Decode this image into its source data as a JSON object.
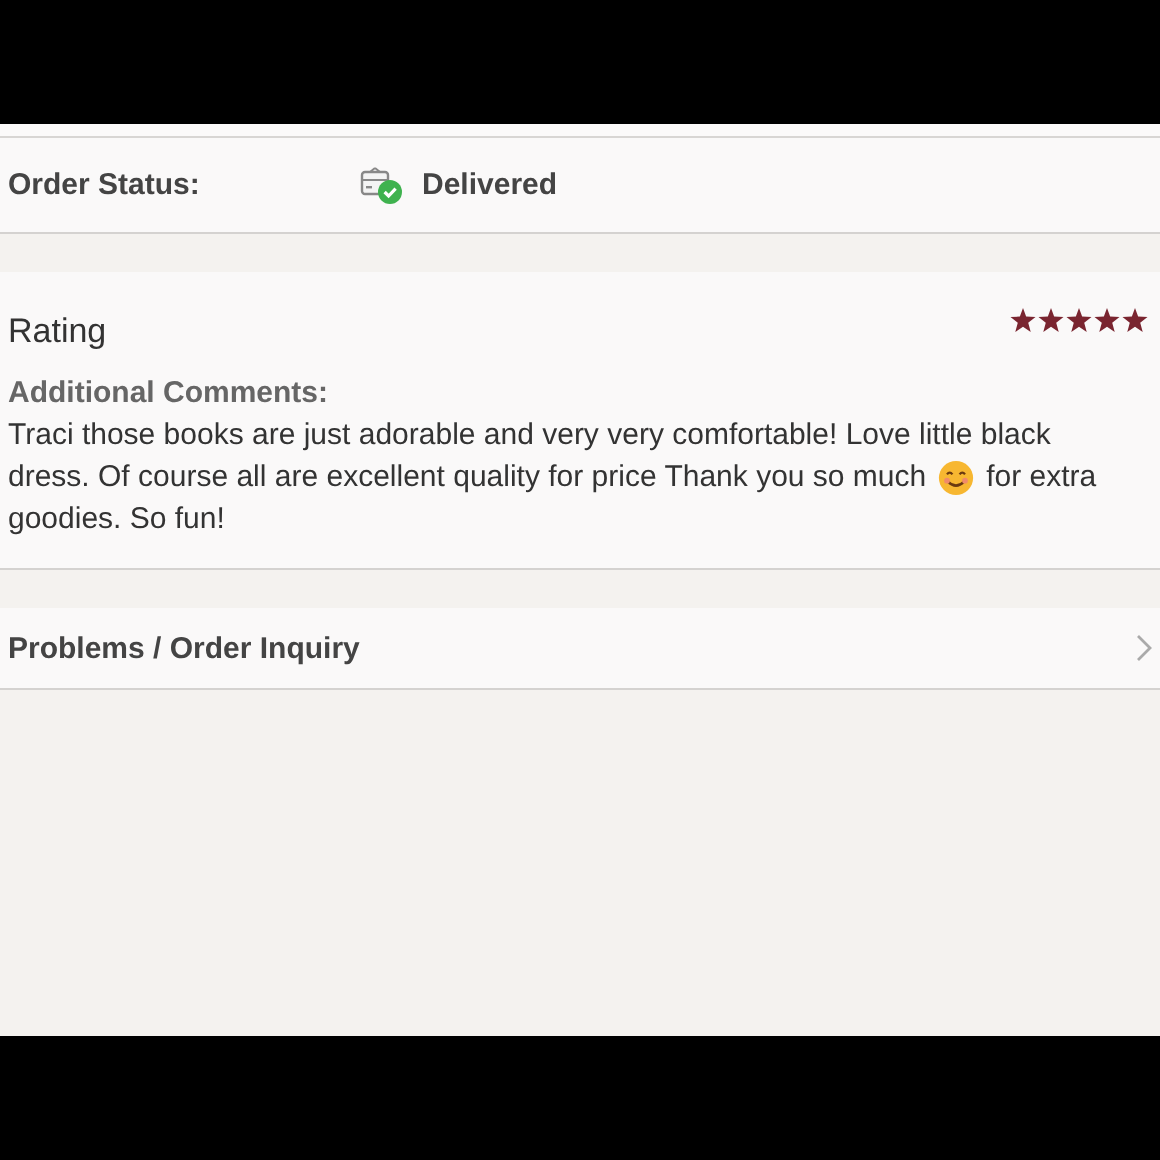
{
  "order_status": {
    "label": "Order Status:",
    "value": "Delivered"
  },
  "rating": {
    "title": "Rating",
    "stars": 5
  },
  "comments": {
    "label": "Additional Comments:",
    "line_1": "Traci those books are just adorable and very very comfortable! Love little black",
    "line_2_before": "dress. Of course all are excellent quality for price Thank you so much",
    "line_2_after": "for extra",
    "line_3": "goodies. So fun!"
  },
  "inquiry": {
    "label": "Problems / Order Inquiry"
  }
}
